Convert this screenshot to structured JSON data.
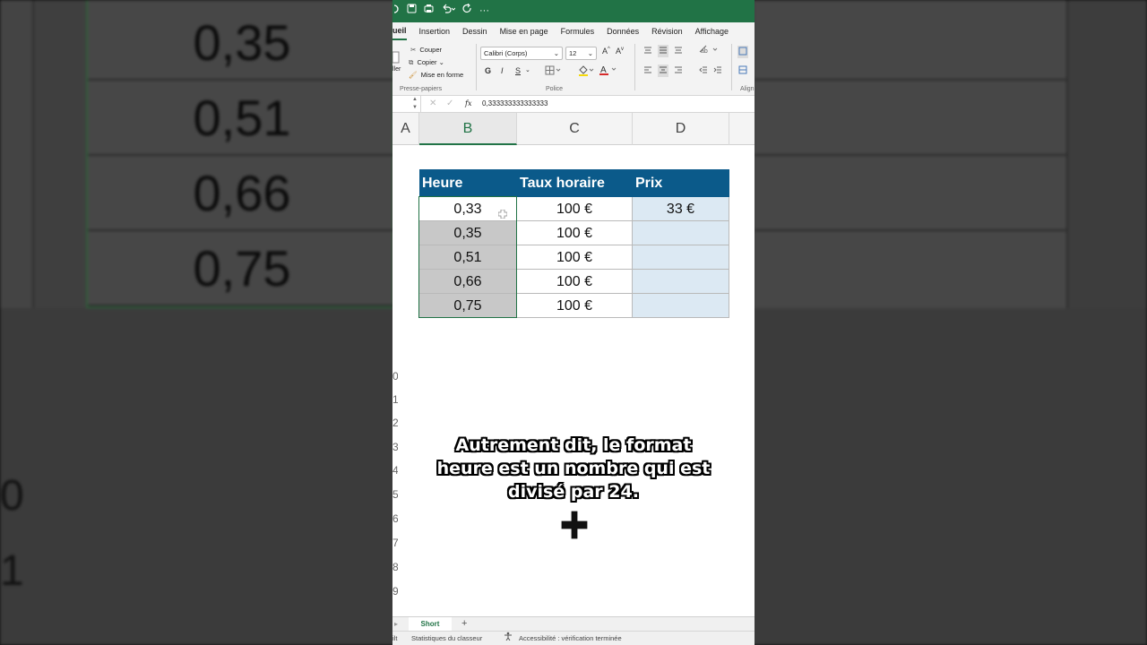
{
  "background": {
    "values": [
      "0,35",
      "0,51",
      "0,66",
      "0,75"
    ],
    "row_numbers": [
      "0",
      "1"
    ]
  },
  "titlebar": {
    "icons": [
      "autosave-icon",
      "save-icon",
      "print-icon",
      "undo-icon",
      "redo-icon",
      "more-icon"
    ],
    "more": "···"
  },
  "ribbon_tabs": [
    "ueil",
    "Insertion",
    "Dessin",
    "Mise en page",
    "Formules",
    "Données",
    "Révision",
    "Affichage"
  ],
  "ribbon": {
    "paste_label": "ller",
    "cut": "Couper",
    "copy": "Copier",
    "format_painter": "Mise en forme",
    "clipboard_group": "Presse-papiers",
    "font_name": "Calibri (Corps)",
    "font_size": "12",
    "bold": "G",
    "italic": "I",
    "underline": "S",
    "font_group": "Police",
    "align_group": "Align"
  },
  "formula_bar": {
    "fx": "fx",
    "content": "0,333333333333333"
  },
  "columns": [
    "A",
    "B",
    "C",
    "D"
  ],
  "row_numbers": [
    "0",
    "1",
    "2",
    "3",
    "4",
    "5",
    "6",
    "7",
    "8",
    "9"
  ],
  "table": {
    "headers": [
      "Heure",
      "Taux horaire",
      "Prix"
    ],
    "rows": [
      {
        "heure": "0,33",
        "taux": "100 €",
        "prix": "33 €"
      },
      {
        "heure": "0,35",
        "taux": "100 €",
        "prix": ""
      },
      {
        "heure": "0,51",
        "taux": "100 €",
        "prix": ""
      },
      {
        "heure": "0,66",
        "taux": "100 €",
        "prix": ""
      },
      {
        "heure": "0,75",
        "taux": "100 €",
        "prix": ""
      }
    ]
  },
  "caption": "Autrement dit, le format heure est un nombre qui est divisé par 24.",
  "sheet_tabs": {
    "active": "Short",
    "add": "+"
  },
  "status_bar": {
    "left": "ilt",
    "stats": "Statistiques du classeur",
    "accessibility": "Accessibilité : vérification terminée"
  },
  "colors": {
    "excel_green": "#217346",
    "header_blue": "#0b5a8a",
    "cell_grey": "#c8c8c8",
    "cell_blue": "#dce9f3"
  }
}
